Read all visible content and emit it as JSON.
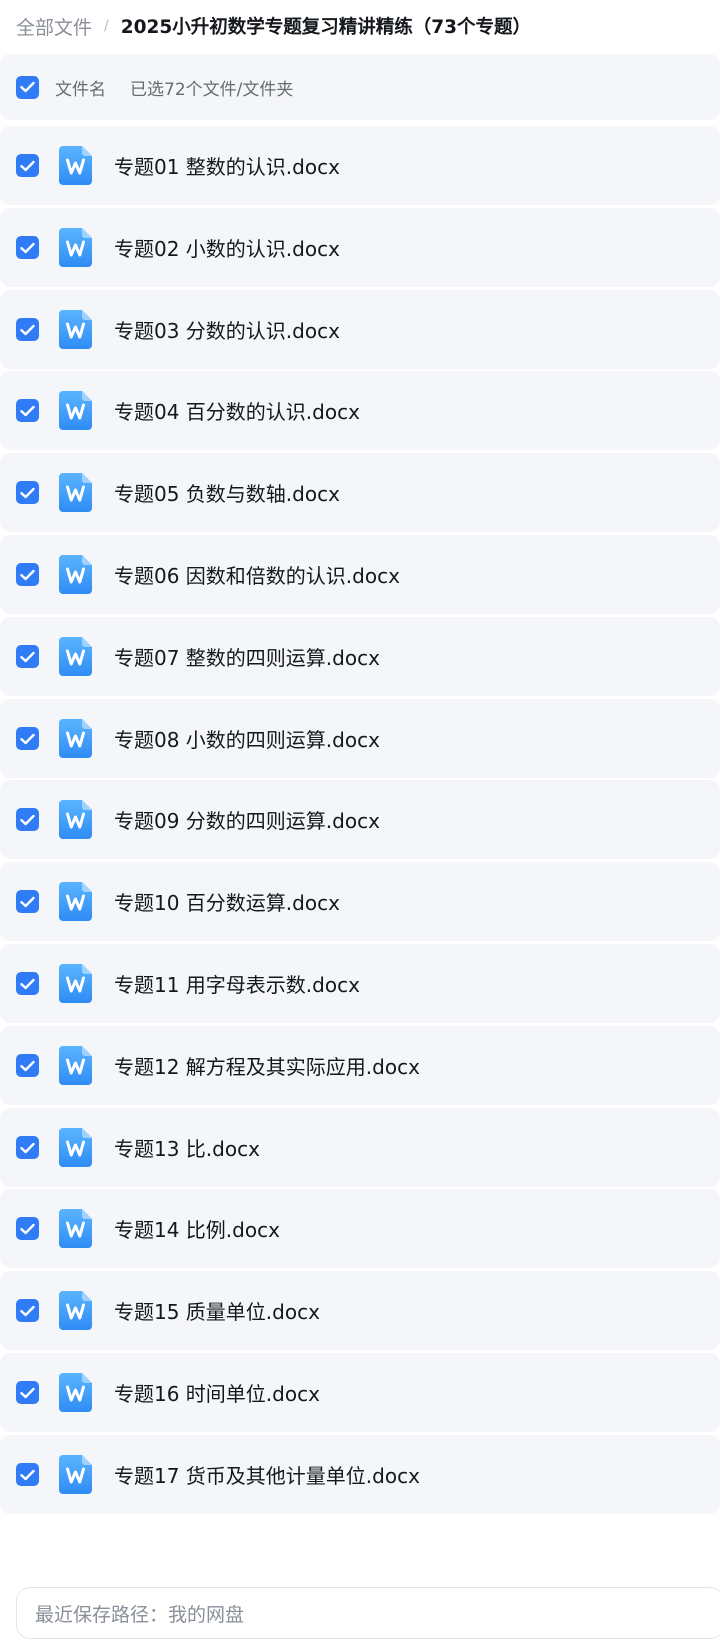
{
  "breadcrumb": {
    "root": "全部文件",
    "separator": "/",
    "current": "2025小升初数学专题复习精讲精练（73个专题）"
  },
  "header": {
    "column_label": "文件名",
    "selection_status": "已选72个文件/文件夹",
    "all_checked": true
  },
  "files": [
    {
      "name": "专题01 整数的认识.docx",
      "checked": true,
      "icon": "word-doc-icon"
    },
    {
      "name": "专题02 小数的认识.docx",
      "checked": true,
      "icon": "word-doc-icon"
    },
    {
      "name": "专题03 分数的认识.docx",
      "checked": true,
      "icon": "word-doc-icon"
    },
    {
      "name": "专题04 百分数的认识.docx",
      "checked": true,
      "icon": "word-doc-icon"
    },
    {
      "name": "专题05 负数与数轴.docx",
      "checked": true,
      "icon": "word-doc-icon"
    },
    {
      "name": "专题06 因数和倍数的认识.docx",
      "checked": true,
      "icon": "word-doc-icon"
    },
    {
      "name": "专题07 整数的四则运算.docx",
      "checked": true,
      "icon": "word-doc-icon"
    },
    {
      "name": "专题08 小数的四则运算.docx",
      "checked": true,
      "icon": "word-doc-icon"
    },
    {
      "name": "专题09 分数的四则运算.docx",
      "checked": true,
      "icon": "word-doc-icon"
    },
    {
      "name": "专题10 百分数运算.docx",
      "checked": true,
      "icon": "word-doc-icon"
    },
    {
      "name": "专题11 用字母表示数.docx",
      "checked": true,
      "icon": "word-doc-icon"
    },
    {
      "name": "专题12 解方程及其实际应用.docx",
      "checked": true,
      "icon": "word-doc-icon"
    },
    {
      "name": "专题13 比.docx",
      "checked": true,
      "icon": "word-doc-icon"
    },
    {
      "name": "专题14 比例.docx",
      "checked": true,
      "icon": "word-doc-icon"
    },
    {
      "name": "专题15 质量单位.docx",
      "checked": true,
      "icon": "word-doc-icon"
    },
    {
      "name": "专题16 时间单位.docx",
      "checked": true,
      "icon": "word-doc-icon"
    },
    {
      "name": "专题17 货币及其他计量单位.docx",
      "checked": true,
      "icon": "word-doc-icon"
    }
  ],
  "footer": {
    "save_path": "最近保存路径：我的网盘"
  },
  "colors": {
    "accent": "#2f7cf6",
    "row_background": "#f5f6f9",
    "word_icon_top": "#5bb4ff",
    "word_icon_bottom": "#2f8cf5"
  }
}
